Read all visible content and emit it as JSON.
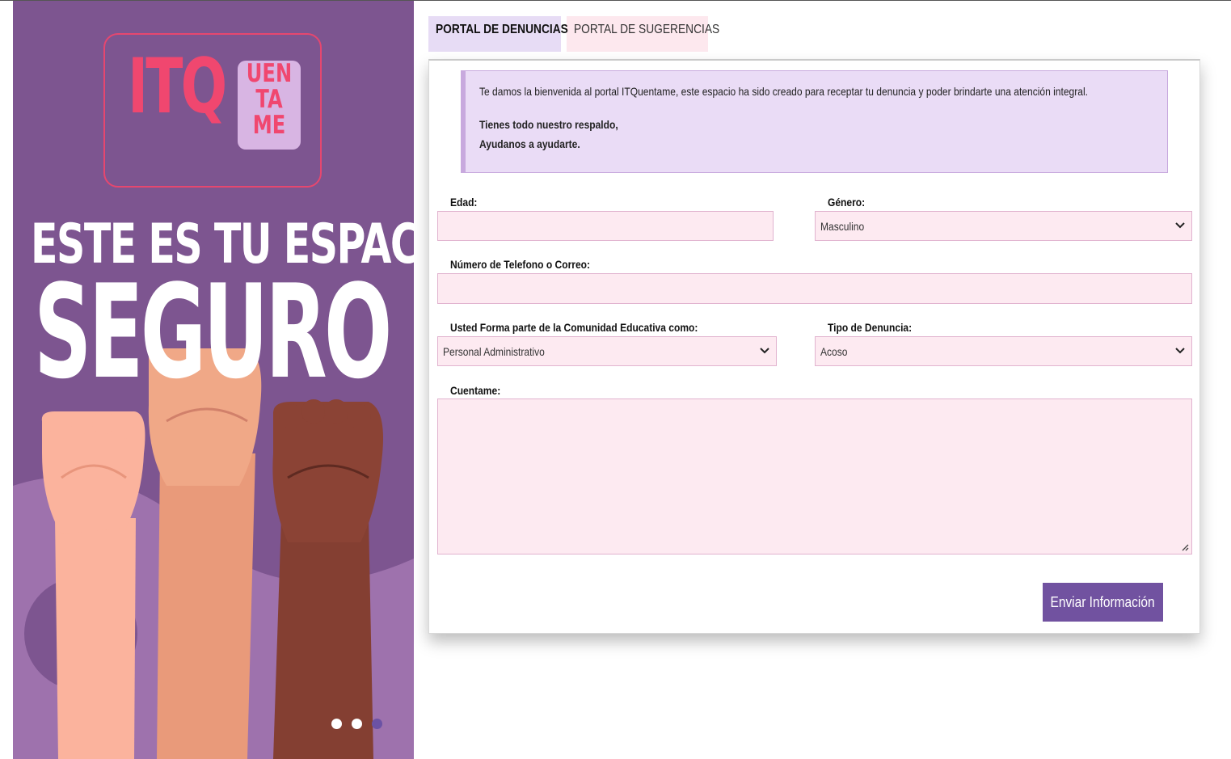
{
  "banner": {
    "logo_main": "ITQ",
    "logo_bubble": [
      "UEN",
      "TA",
      "ME"
    ],
    "headline_line1": "ESTE ES TU ESPACIO",
    "headline_line2": "SEGURO",
    "carousel": {
      "slides": 3,
      "active_index": 2
    },
    "colors": {
      "background": "#7d5590",
      "logo_pink": "#f0476f",
      "dot_active": "#6b52a5"
    }
  },
  "tabs": [
    {
      "label": "PORTAL DE DENUNCIAS",
      "active": true
    },
    {
      "label": "PORTAL DE SUGERENCIAS",
      "active": false
    }
  ],
  "welcome": {
    "intro": "Te damos la bienvenida al portal ITQuentame, este espacio ha sido creado para receptar tu denuncia y poder brindarte una atención integral.",
    "support": "Tienes todo nuestro respaldo,",
    "help": "Ayudanos a ayudarte."
  },
  "form": {
    "edad": {
      "label": "Edad:",
      "value": ""
    },
    "genero": {
      "label": "Género:",
      "value": "Masculino"
    },
    "contacto": {
      "label": "Número de Telefono o Correo:",
      "value": ""
    },
    "comunidad": {
      "label": "Usted Forma parte de la Comunidad Educativa como:",
      "value": "Personal Administrativo"
    },
    "tipo": {
      "label": "Tipo de Denuncia:",
      "value": "Acoso"
    },
    "cuentame": {
      "label": "Cuentame:",
      "value": ""
    },
    "submit_label": "Enviar Información"
  },
  "colors": {
    "accent": "#7152a0",
    "tab_active_bg": "#e7dcf5",
    "tab_inactive_bg": "#fde8ee",
    "field_bg": "#fdeaf1",
    "welcome_bg": "#eadcf6"
  }
}
